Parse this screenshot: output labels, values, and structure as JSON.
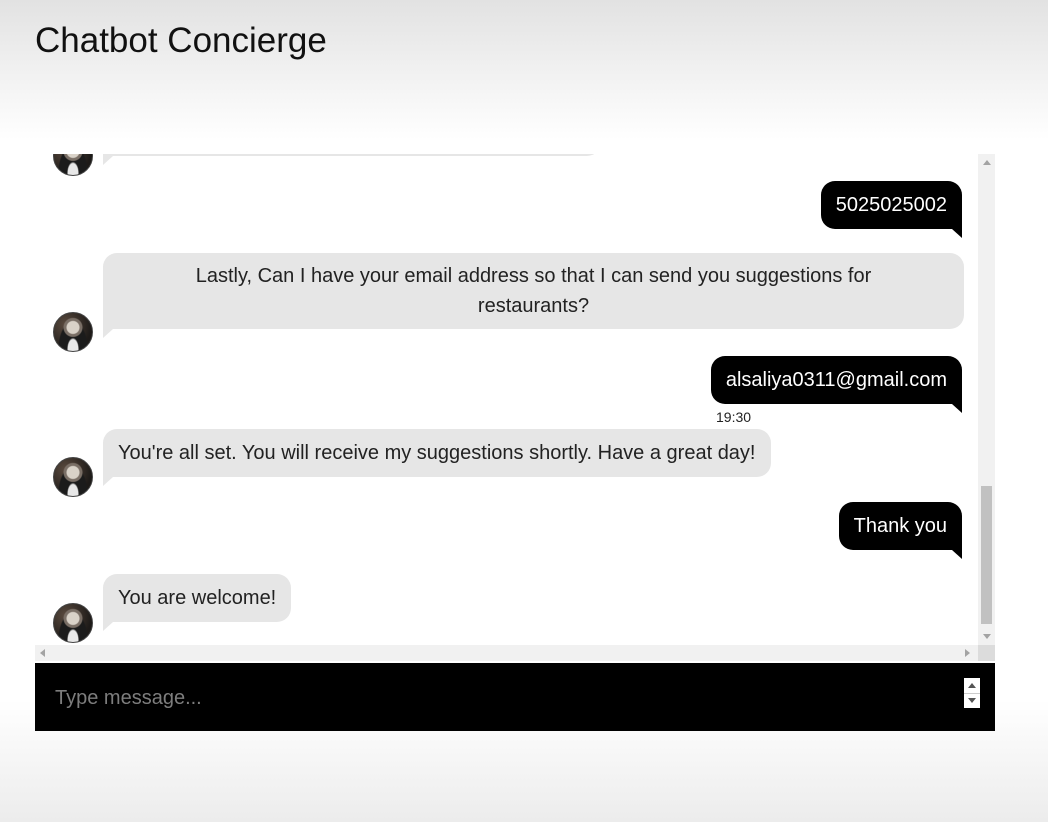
{
  "app": {
    "title": "Chatbot Concierge"
  },
  "messages": [
    {
      "sender": "user",
      "text": "5025025002"
    },
    {
      "sender": "bot",
      "text": "Lastly, Can I have your email address so that I can send you suggestions for restaurants?"
    },
    {
      "sender": "user",
      "text": "alsaliya0311@gmail.com",
      "time": "19:30"
    },
    {
      "sender": "bot",
      "text": "You're all set. You will receive my suggestions shortly. Have a great day!"
    },
    {
      "sender": "user",
      "text": "Thank you"
    },
    {
      "sender": "bot",
      "text": "You are welcome!"
    }
  ],
  "composer": {
    "placeholder": "Type message..."
  },
  "icons": {
    "avatar": "bot-avatar-icon",
    "scroll_up": "scroll-up-arrow-icon",
    "scroll_down": "scroll-down-arrow-icon",
    "scroll_left": "scroll-left-arrow-icon",
    "scroll_right": "scroll-right-arrow-icon"
  },
  "colors": {
    "user_bubble": "#000000",
    "bot_bubble": "#e6e6e6",
    "input_bar": "#000000"
  }
}
